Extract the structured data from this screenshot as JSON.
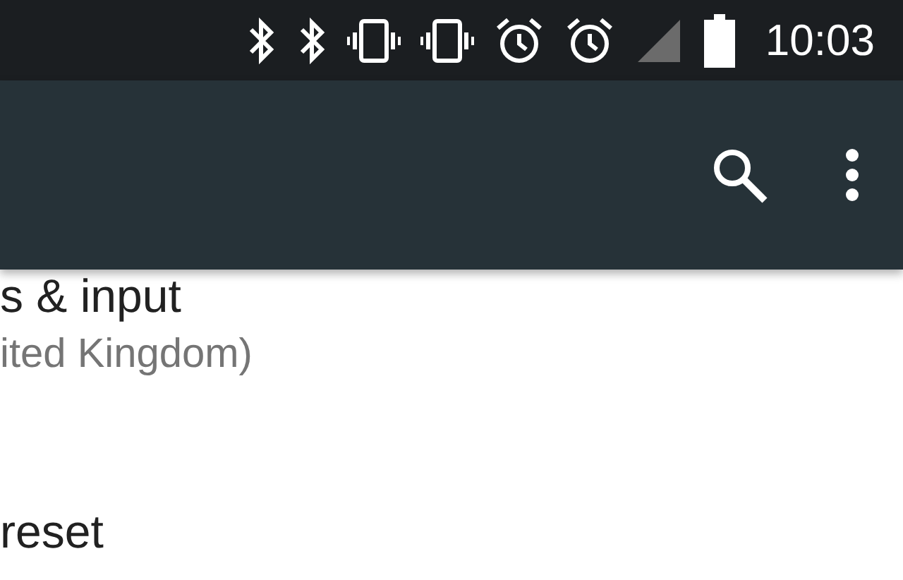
{
  "status_bar": {
    "icons": [
      {
        "kind": "bluetooth"
      },
      {
        "kind": "bluetooth"
      },
      {
        "kind": "vibrate"
      },
      {
        "kind": "vibrate"
      },
      {
        "kind": "alarm"
      },
      {
        "kind": "alarm"
      },
      {
        "kind": "signal"
      },
      {
        "kind": "battery"
      }
    ],
    "time": "10:03"
  },
  "toolbar": {
    "actions": [
      {
        "kind": "search"
      },
      {
        "kind": "more"
      }
    ]
  },
  "settings_items": [
    {
      "title": "s & input",
      "summary": "ited Kingdom)"
    },
    {
      "title": "reset"
    }
  ]
}
